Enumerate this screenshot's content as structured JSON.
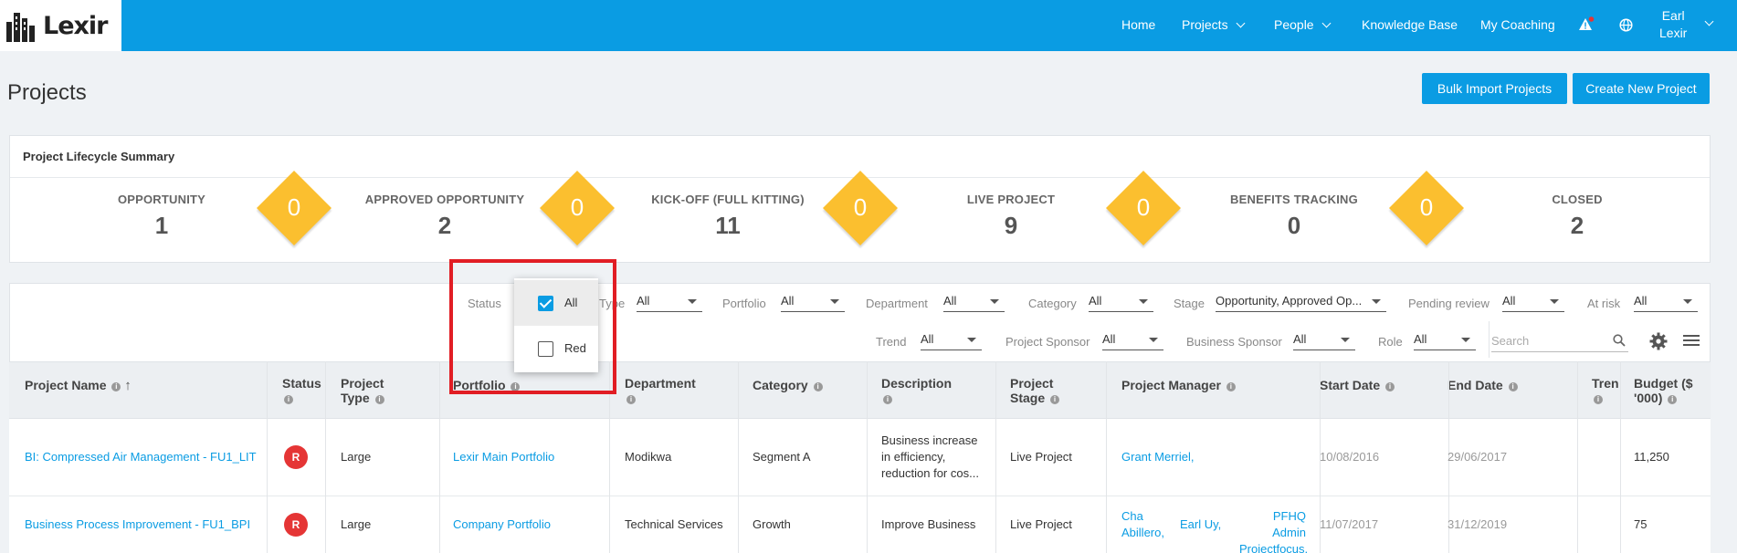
{
  "brand": {
    "logo_text": "Lexir"
  },
  "nav": {
    "items": [
      {
        "label": "Home"
      },
      {
        "label": "Projects"
      },
      {
        "label": "People"
      },
      {
        "label": "Knowledge Base"
      },
      {
        "label": "My Coaching"
      }
    ],
    "user_first": "Earl",
    "user_last": "Lexir",
    "icons": [
      "alert-icon",
      "globe-icon"
    ]
  },
  "page": {
    "title": "Projects",
    "bulk_import_label": "Bulk Import Projects",
    "create_label": "Create New Project"
  },
  "summary": {
    "title": "Project Lifecycle Summary",
    "stages": [
      {
        "label": "OPPORTUNITY",
        "count": "1"
      },
      {
        "label": "APPROVED OPPORTUNITY",
        "count": "2"
      },
      {
        "label": "KICK-OFF (FULL KITTING)",
        "count": "11"
      },
      {
        "label": "LIVE PROJECT",
        "count": "9"
      },
      {
        "label": "BENEFITS TRACKING",
        "count": "0"
      },
      {
        "label": "CLOSED",
        "count": "2"
      }
    ],
    "diamonds": [
      "0",
      "0",
      "0",
      "0",
      "0"
    ]
  },
  "filters": {
    "status_label": "Status",
    "type": {
      "label": "Type",
      "value": "All"
    },
    "portfolio": {
      "label": "Portfolio",
      "value": "All"
    },
    "department": {
      "label": "Department",
      "value": "All"
    },
    "category": {
      "label": "Category",
      "value": "All"
    },
    "stage": {
      "label": "Stage",
      "value": "Opportunity, Approved Op..."
    },
    "pending_review": {
      "label": "Pending review",
      "value": "All"
    },
    "at_risk": {
      "label": "At risk",
      "value": "All"
    },
    "trend": {
      "label": "Trend",
      "value": "All"
    },
    "project_sponsor": {
      "label": "Project Sponsor",
      "value": "All"
    },
    "business_sponsor": {
      "label": "Business Sponsor",
      "value": "All"
    },
    "role": {
      "label": "Role",
      "value": "All"
    },
    "search_placeholder": "Search"
  },
  "status_popup": {
    "options": [
      {
        "label": "All",
        "checked": true
      },
      {
        "label": "Red",
        "checked": false
      }
    ]
  },
  "table": {
    "columns": {
      "project_name": "Project Name",
      "status": "Status",
      "project_type_1": "Project",
      "project_type_2": "Type",
      "portfolio": "Portfolio",
      "department": "Department",
      "category": "Category",
      "description": "Description",
      "project_stage_1": "Project",
      "project_stage_2": "Stage",
      "project_manager": "Project Manager",
      "start_date": "Start Date",
      "end_date": "End Date",
      "trend": "Trend",
      "budget_1": "Budget ($",
      "budget_2": "'000)"
    },
    "rows": [
      {
        "name": "BI: Compressed Air Management - FU1_LIT",
        "status": "R",
        "type": "Large",
        "portfolio": "Lexir Main Portfolio",
        "department": "Modikwa",
        "category": "Segment A",
        "description_1": "Business increase",
        "description_2": "in efficiency,",
        "description_3": "reduction for cos...",
        "stage": "Live Project",
        "manager": "Grant Merriel,",
        "start": "10/08/2016",
        "end": "29/06/2017",
        "budget": "11,250"
      },
      {
        "name": "Business Process Improvement - FU1_BPI",
        "status": "R",
        "type": "Large",
        "portfolio": "Company Portfolio",
        "department": "Technical Services",
        "category": "Growth",
        "description_1": "Improve Business",
        "stage": "Live Project",
        "manager_1a": "Cha",
        "manager_1b": "Abillero,",
        "manager_2": "Earl Uy,",
        "manager_3a": "PFHQ Admin",
        "manager_3b": "Projectfocus,",
        "start": "11/07/2017",
        "end": "31/12/2019",
        "budget": "75"
      }
    ]
  }
}
